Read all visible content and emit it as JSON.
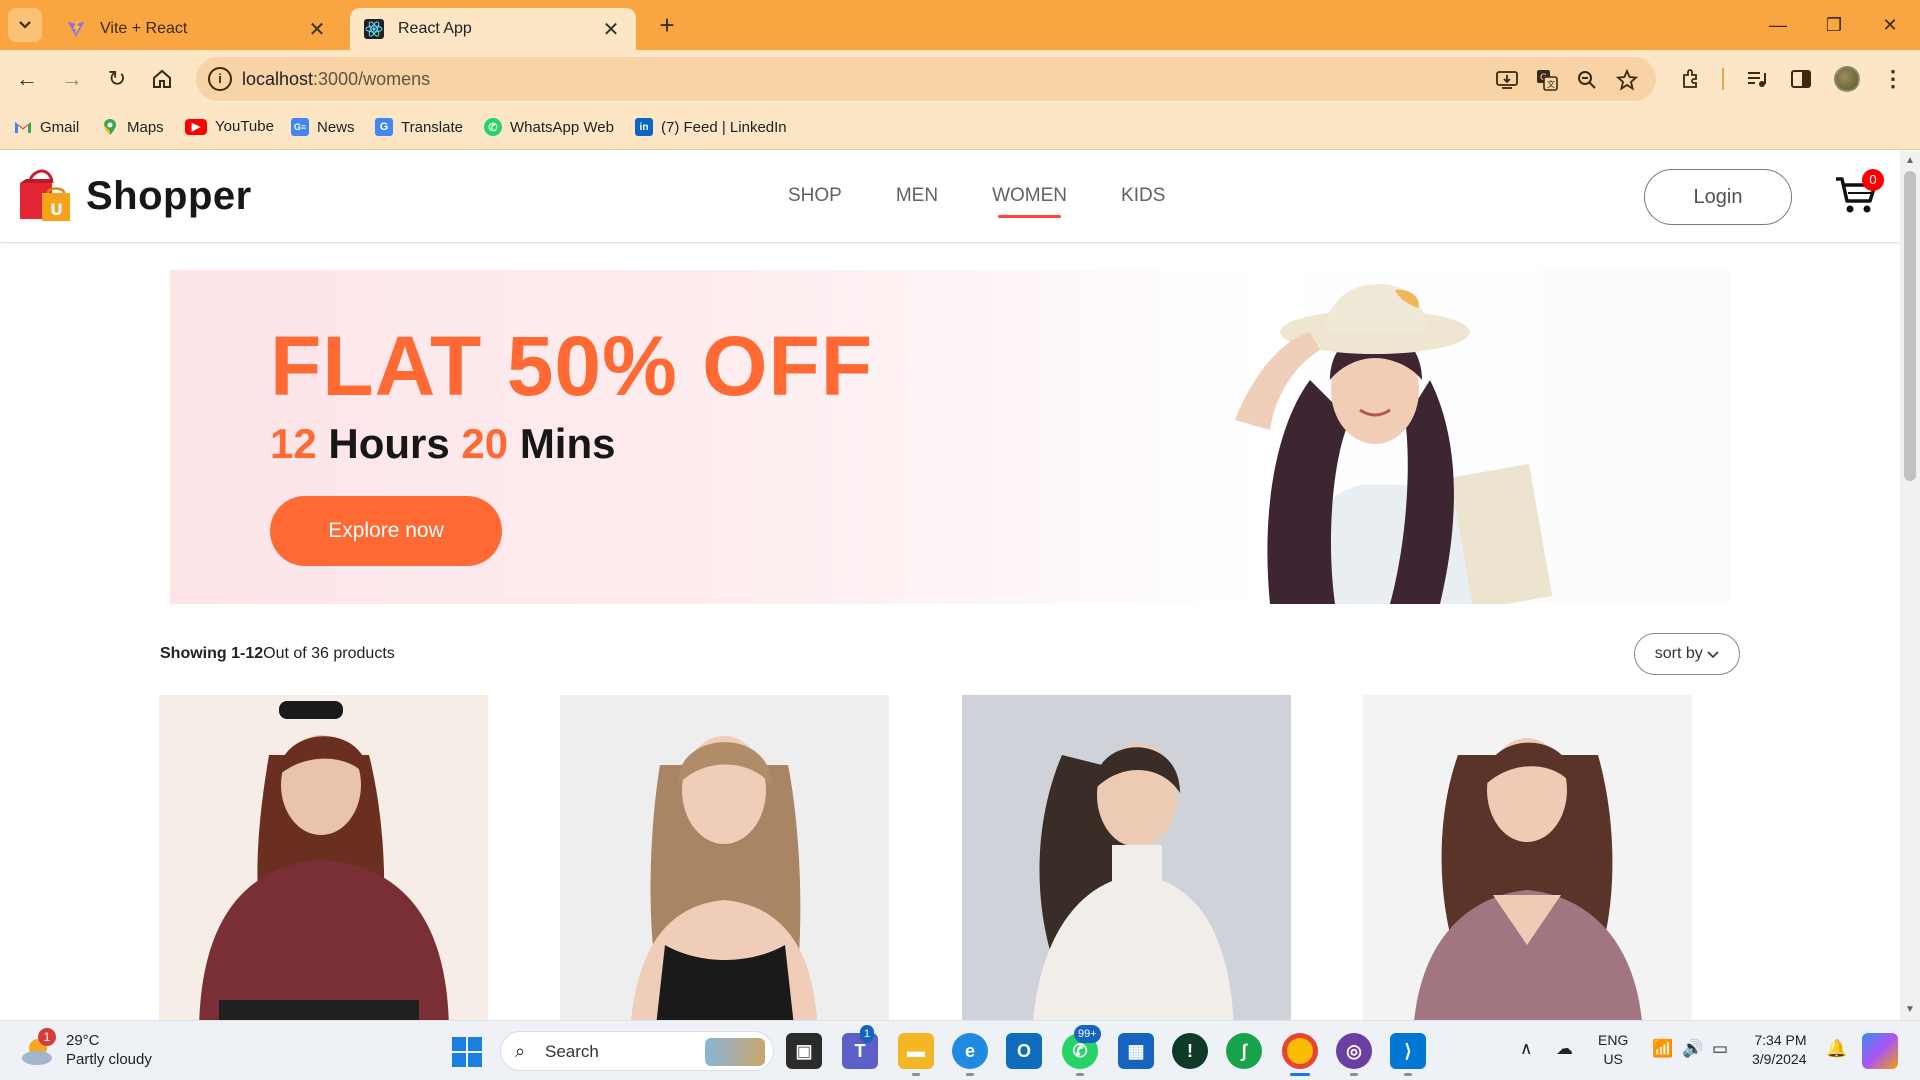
{
  "browser": {
    "tabs": [
      {
        "title": "Vite + React",
        "active": false
      },
      {
        "title": "React App",
        "active": true
      }
    ],
    "new_tab_label": "+",
    "address": {
      "host": "localhost",
      "path": ":3000/womens"
    },
    "bookmarks": [
      {
        "label": "Gmail",
        "icon": "gmail-icon"
      },
      {
        "label": "Maps",
        "icon": "maps-icon"
      },
      {
        "label": "YouTube",
        "icon": "youtube-icon"
      },
      {
        "label": "News",
        "icon": "news-icon"
      },
      {
        "label": "Translate",
        "icon": "translate-icon"
      },
      {
        "label": "WhatsApp Web",
        "icon": "whatsapp-icon"
      },
      {
        "label": "(7) Feed | LinkedIn",
        "icon": "linkedin-icon"
      }
    ]
  },
  "shop": {
    "logo_text": "Shopper",
    "menu": [
      "SHOP",
      "MEN",
      "WOMEN",
      "KIDS"
    ],
    "active_menu": "WOMEN",
    "login_label": "Login",
    "cart_count": "0",
    "banner": {
      "title": "FLAT 50% OFF",
      "hours_num": "12",
      "hours_label": "Hours",
      "mins_num": "20",
      "mins_label": "Mins",
      "button_label": "Explore now"
    },
    "showing_bold": "Showing 1-12",
    "showing_rest": "Out of 36 products",
    "sort_label": "sort by",
    "products": [
      {
        "color": "#7a2f36"
      },
      {
        "color": "#1a1a1a"
      },
      {
        "color": "#f1eee9"
      },
      {
        "color": "#a27680"
      }
    ]
  },
  "taskbar": {
    "weather_temp": "29°C",
    "weather_desc": "Partly cloudy",
    "weather_badge": "1",
    "search_label": "Search",
    "teams_badge": "1",
    "whatsapp_badge": "99+",
    "language": "ENG",
    "region": "US",
    "time": "7:34 PM",
    "date": "3/9/2024"
  }
}
